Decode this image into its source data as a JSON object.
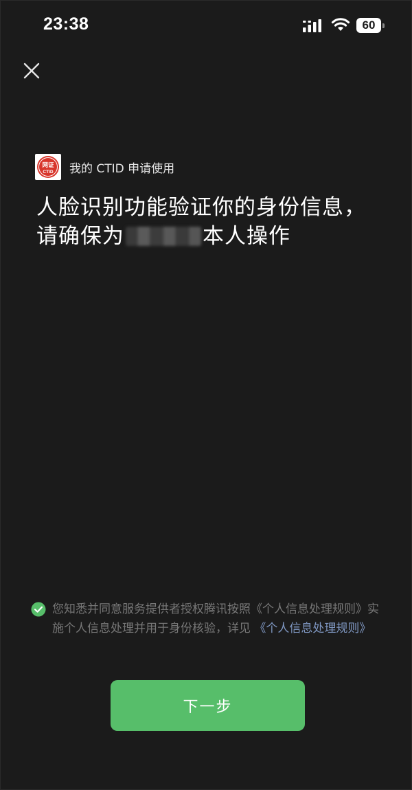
{
  "status_bar": {
    "time": "23:38",
    "battery": "60",
    "icons": [
      "signal-icon",
      "wifi-icon",
      "battery-icon"
    ]
  },
  "header": {
    "close_icon": "close-icon"
  },
  "app": {
    "logo_icon": "ctid-logo",
    "logo_text_top": "网证",
    "logo_text_bottom": "CTID",
    "request_text": "我的 CTID 申请使用"
  },
  "headline": {
    "prefix": "人脸识别功能验证你的身份信息，请确保为",
    "suffix": "本人操作"
  },
  "consent": {
    "checked": true,
    "text_part1": "您知悉并同意服务提供者授权腾讯按照《个人信息处理规则》实施个人信息处理并用于身份核验，详见",
    "link_text": "《个人信息处理规则》"
  },
  "actions": {
    "next_label": "下一步"
  },
  "colors": {
    "background": "#1b1b1b",
    "accent_green": "#57be6a",
    "link_blue": "#7f97c2",
    "muted_text": "#777777",
    "logo_red": "#d8362c"
  }
}
